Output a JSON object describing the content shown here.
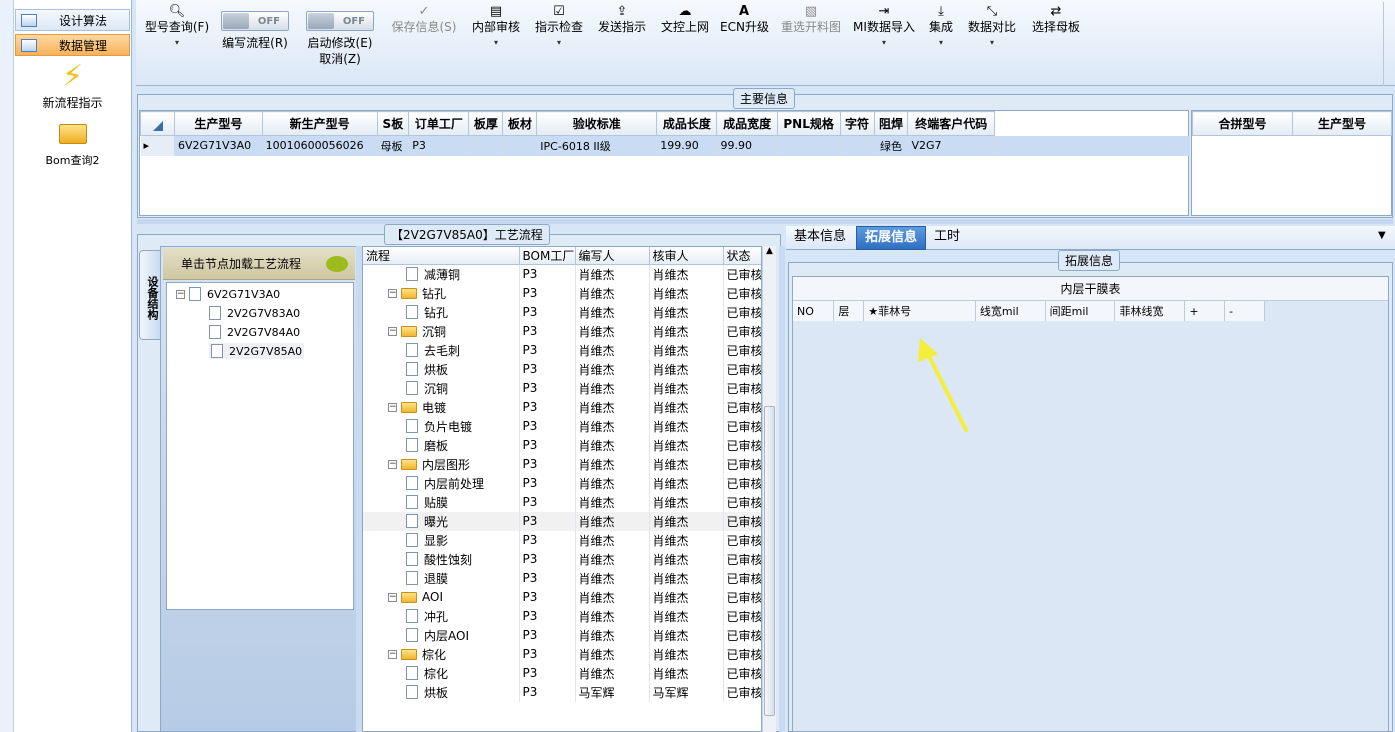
{
  "nav": {
    "items": [
      "设计算法",
      "数据管理"
    ],
    "big_items": [
      "新流程指示",
      "Bom查询2"
    ]
  },
  "toolbar": {
    "model_query": "型号查询(F)",
    "edit_flow": "编写流程(R)",
    "toggle_off": "OFF",
    "start_modify": "启动修改(E)",
    "cancel": "取消(Z)",
    "save_info": "保存信息(S)",
    "internal_review": "内部审核",
    "instruction_check": "指示检查",
    "send_instruction": "发送指示",
    "doc_online": "文控上网",
    "ecn_upgrade": "ECN升级",
    "reselect_cut": "重选开料图",
    "mi_import": "MI数据导入",
    "integrate": "集成",
    "data_compare": "数据对比",
    "select_mother": "选择母板"
  },
  "main_info": {
    "legend": "主要信息",
    "columns": [
      "生产型号",
      "新生产型号",
      "S板",
      "订单工厂",
      "板厚",
      "板材",
      "验收标准",
      "成品长度",
      "成品宽度",
      "PNL规格",
      "字符",
      "阻焊",
      "终端客户代码"
    ],
    "row": [
      "6V2G71V3A0",
      "10010600056026",
      "母板",
      "P3",
      "",
      "",
      "IPC-6018 II级",
      "199.90",
      "99.90",
      "",
      "",
      "绿色",
      "V2G7"
    ],
    "merge_columns": [
      "合拼型号",
      "生产型号"
    ]
  },
  "flow": {
    "legend": "【2V2G7V85A0】工艺流程",
    "side_tab": "设备结构",
    "tip": "单击节点加载工艺流程",
    "tree": [
      "6V2G71V3A0",
      "2V2G7V83A0",
      "2V2G7V84A0",
      "2V2G7V85A0"
    ],
    "columns": [
      "流程",
      "BOM工厂",
      "编写人",
      "核审人",
      "状态"
    ],
    "rows": [
      {
        "name": "减薄铜",
        "type": "file",
        "bom": "P3",
        "writer": "肖维杰",
        "reviewer": "肖维杰",
        "status": "已审核"
      },
      {
        "name": "钻孔",
        "type": "folder",
        "bom": "P3",
        "writer": "肖维杰",
        "reviewer": "肖维杰",
        "status": "已审核"
      },
      {
        "name": "钻孔",
        "type": "file",
        "bom": "P3",
        "writer": "肖维杰",
        "reviewer": "肖维杰",
        "status": "已审核"
      },
      {
        "name": "沉铜",
        "type": "folder",
        "bom": "P3",
        "writer": "肖维杰",
        "reviewer": "肖维杰",
        "status": "已审核"
      },
      {
        "name": "去毛刺",
        "type": "file",
        "bom": "P3",
        "writer": "肖维杰",
        "reviewer": "肖维杰",
        "status": "已审核"
      },
      {
        "name": "烘板",
        "type": "file",
        "bom": "P3",
        "writer": "肖维杰",
        "reviewer": "肖维杰",
        "status": "已审核"
      },
      {
        "name": "沉铜",
        "type": "file",
        "bom": "P3",
        "writer": "肖维杰",
        "reviewer": "肖维杰",
        "status": "已审核"
      },
      {
        "name": "电镀",
        "type": "folder",
        "bom": "P3",
        "writer": "肖维杰",
        "reviewer": "肖维杰",
        "status": "已审核"
      },
      {
        "name": "负片电镀",
        "type": "file",
        "bom": "P3",
        "writer": "肖维杰",
        "reviewer": "肖维杰",
        "status": "已审核"
      },
      {
        "name": "磨板",
        "type": "file",
        "bom": "P3",
        "writer": "肖维杰",
        "reviewer": "肖维杰",
        "status": "已审核"
      },
      {
        "name": "内层图形",
        "type": "folder",
        "bom": "P3",
        "writer": "肖维杰",
        "reviewer": "肖维杰",
        "status": "已审核"
      },
      {
        "name": "内层前处理",
        "type": "file",
        "bom": "P3",
        "writer": "肖维杰",
        "reviewer": "肖维杰",
        "status": "已审核"
      },
      {
        "name": "贴膜",
        "type": "file",
        "bom": "P3",
        "writer": "肖维杰",
        "reviewer": "肖维杰",
        "status": "已审核"
      },
      {
        "name": "曝光",
        "type": "file",
        "bom": "P3",
        "writer": "肖维杰",
        "reviewer": "肖维杰",
        "status": "已审核"
      },
      {
        "name": "显影",
        "type": "file",
        "bom": "P3",
        "writer": "肖维杰",
        "reviewer": "肖维杰",
        "status": "已审核"
      },
      {
        "name": "酸性蚀刻",
        "type": "file",
        "bom": "P3",
        "writer": "肖维杰",
        "reviewer": "肖维杰",
        "status": "已审核"
      },
      {
        "name": "退膜",
        "type": "file",
        "bom": "P3",
        "writer": "肖维杰",
        "reviewer": "肖维杰",
        "status": "已审核"
      },
      {
        "name": "AOI",
        "type": "folder",
        "bom": "P3",
        "writer": "肖维杰",
        "reviewer": "肖维杰",
        "status": "已审核"
      },
      {
        "name": "冲孔",
        "type": "file",
        "bom": "P3",
        "writer": "肖维杰",
        "reviewer": "肖维杰",
        "status": "已审核"
      },
      {
        "name": "内层AOI",
        "type": "file",
        "bom": "P3",
        "writer": "肖维杰",
        "reviewer": "肖维杰",
        "status": "已审核"
      },
      {
        "name": "棕化",
        "type": "folder",
        "bom": "P3",
        "writer": "肖维杰",
        "reviewer": "肖维杰",
        "status": "已审核"
      },
      {
        "name": "棕化",
        "type": "file",
        "bom": "P3",
        "writer": "肖维杰",
        "reviewer": "肖维杰",
        "status": "已审核"
      },
      {
        "name": "烘板",
        "type": "file",
        "bom": "P3",
        "writer": "马军辉",
        "reviewer": "马军辉",
        "status": "已审核"
      }
    ]
  },
  "right": {
    "tabs": [
      "基本信息",
      "拓展信息",
      "工时"
    ],
    "legend": "拓展信息",
    "table_title": "内层干膜表",
    "columns": [
      "NO",
      "层",
      "★菲林号",
      "线宽mil",
      "间距mil",
      "菲林线宽",
      "+",
      "-"
    ]
  }
}
